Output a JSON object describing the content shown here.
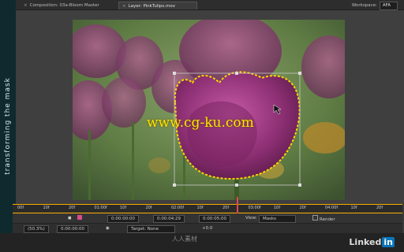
{
  "sidebar": {
    "title": "transforming the mask"
  },
  "tabs": [
    {
      "label": "Composition: 03a-Bloom Master",
      "active": false
    },
    {
      "label": "Layer: PinkTulips.mov",
      "active": true
    }
  ],
  "workspace": {
    "label": "Workspace:",
    "value": "AFA"
  },
  "watermark": "www.cg-ku.com",
  "timeline": {
    "ticks": [
      "00f",
      "10f",
      "20f",
      "01:00f",
      "10f",
      "20f",
      "02:00f",
      "10f",
      "20f",
      "03:00f",
      "10f",
      "20f",
      "04:00f",
      "10f",
      "20f"
    ]
  },
  "controls": {
    "zoom": "100%",
    "time_start": "0:00:00:00",
    "time_end": "0:00:04:29",
    "duration": "0:00:05:00",
    "view_label": "View:",
    "view_value": "Masks",
    "render_label": "Render"
  },
  "controls2": {
    "zoom2": "(50.3%)",
    "timecode": "0:00:00:00",
    "target_label": "Target: None",
    "exposure": "+0.0"
  },
  "branding": {
    "linkedin_text": "Linked",
    "linkedin_in": "in",
    "cn_text": "人人素材"
  },
  "colors": {
    "mask_path": "#ffd400",
    "timeline_accent": "#ffb000",
    "sidebar_bg": "#0f2a2e"
  }
}
